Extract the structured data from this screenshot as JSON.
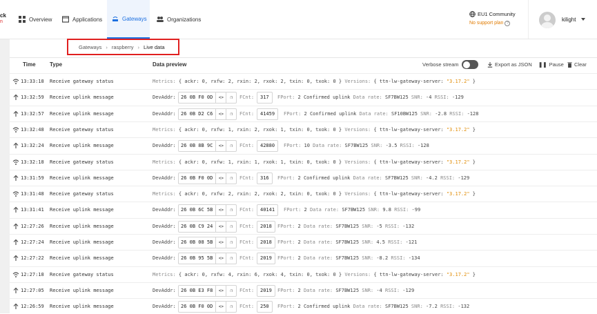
{
  "logo": {
    "line1": "ck",
    "line2": "n"
  },
  "nav": [
    {
      "label": "Overview",
      "icon": "overview-icon"
    },
    {
      "label": "Applications",
      "icon": "applications-icon"
    },
    {
      "label": "Gateways",
      "icon": "gateways-icon",
      "active": true
    },
    {
      "label": "Organizations",
      "icon": "organizations-icon"
    }
  ],
  "cluster": {
    "name": "EU1 Community",
    "plan": "No support plan"
  },
  "user": {
    "name": "kilight"
  },
  "breadcrumb": {
    "items": [
      "Gateways",
      "raspberry"
    ],
    "current": "Live data"
  },
  "table": {
    "headers": {
      "time": "Time",
      "type": "Type",
      "preview": "Data preview"
    },
    "tools": {
      "verbose": "Verbose stream",
      "export": "Export as JSON",
      "pause": "Pause",
      "clear": "Clear"
    }
  },
  "labels": {
    "metrics": "Metrics:",
    "versions": "Versions:",
    "devaddr": "DevAddr:",
    "fcnt": "FCnt:",
    "fport": "FPort:",
    "confirmed": "Confirmed uplink",
    "datarate": "Data rate:",
    "snr": "SNR:",
    "rssi": "RSSI:",
    "server": "ttn-lw-gateway-server:"
  },
  "rows": [
    {
      "kind": "status",
      "time": "13:33:18",
      "type": "Receive gateway status",
      "ackr": "0",
      "rxfw": "2",
      "rxin": "2",
      "rxok": "2",
      "txin": "0",
      "txok": "0",
      "version": "\"3.17.2\""
    },
    {
      "kind": "uplink",
      "time": "13:32:59",
      "type": "Receive uplink message",
      "devaddr": "26 0B F0 0D",
      "fcnt": "317",
      "fport": "2",
      "confirmed": true,
      "datarate": "SF7BW125",
      "snr": "-4",
      "rssi": "-129"
    },
    {
      "kind": "uplink",
      "time": "13:32:57",
      "type": "Receive uplink message",
      "devaddr": "26 0B D2 C6",
      "fcnt": "41459",
      "fport": "2",
      "confirmed": true,
      "datarate": "SF10BW125",
      "snr": "-2.8",
      "rssi": "-128"
    },
    {
      "kind": "status",
      "time": "13:32:48",
      "type": "Receive gateway status",
      "ackr": "0",
      "rxfw": "1",
      "rxin": "2",
      "rxok": "1",
      "txin": "0",
      "txok": "0",
      "version": "\"3.17.2\""
    },
    {
      "kind": "uplink",
      "time": "13:32:24",
      "type": "Receive uplink message",
      "devaddr": "26 0B 8B 9C",
      "fcnt": "42880",
      "fport": "10",
      "confirmed": false,
      "datarate": "SF7BW125",
      "snr": "-3.5",
      "rssi": "-128"
    },
    {
      "kind": "status",
      "time": "13:32:18",
      "type": "Receive gateway status",
      "ackr": "0",
      "rxfw": "1",
      "rxin": "1",
      "rxok": "1",
      "txin": "0",
      "txok": "0",
      "version": "\"3.17.2\""
    },
    {
      "kind": "uplink",
      "time": "13:31:59",
      "type": "Receive uplink message",
      "devaddr": "26 0B F0 0D",
      "fcnt": "316",
      "fport": "2",
      "confirmed": true,
      "datarate": "SF7BW125",
      "snr": "-4.2",
      "rssi": "-129"
    },
    {
      "kind": "status",
      "time": "13:31:48",
      "type": "Receive gateway status",
      "ackr": "0",
      "rxfw": "2",
      "rxin": "2",
      "rxok": "2",
      "txin": "0",
      "txok": "0",
      "version": "\"3.17.2\""
    },
    {
      "kind": "uplink",
      "time": "13:31:41",
      "type": "Receive uplink message",
      "devaddr": "26 0B 6C 5B",
      "fcnt": "40141",
      "fport": "2",
      "confirmed": false,
      "datarate": "SF7BW125",
      "snr": "9.8",
      "rssi": "-99"
    },
    {
      "kind": "uplink",
      "time": "12:27:26",
      "type": "Receive uplink message",
      "devaddr": "26 0B C9 24",
      "fcnt": "2018",
      "fport": "2",
      "confirmed": false,
      "datarate": "SF7BW125",
      "snr": "-5",
      "rssi": "-132"
    },
    {
      "kind": "uplink",
      "time": "12:27:24",
      "type": "Receive uplink message",
      "devaddr": "26 0B 08 5B",
      "fcnt": "2018",
      "fport": "2",
      "confirmed": false,
      "datarate": "SF7BW125",
      "snr": "4.5",
      "rssi": "-121"
    },
    {
      "kind": "uplink",
      "time": "12:27:22",
      "type": "Receive uplink message",
      "devaddr": "26 0B 95 5B",
      "fcnt": "2019",
      "fport": "2",
      "confirmed": false,
      "datarate": "SF7BW125",
      "snr": "-8.2",
      "rssi": "-134"
    },
    {
      "kind": "status",
      "time": "12:27:18",
      "type": "Receive gateway status",
      "ackr": "0",
      "rxfw": "4",
      "rxin": "6",
      "rxok": "4",
      "txin": "0",
      "txok": "0",
      "version": "\"3.17.2\""
    },
    {
      "kind": "uplink",
      "time": "12:27:05",
      "type": "Receive uplink message",
      "devaddr": "26 0B E3 F8",
      "fcnt": "2019",
      "fport": "2",
      "confirmed": false,
      "datarate": "SF7BW125",
      "snr": "-4",
      "rssi": "-129"
    },
    {
      "kind": "uplink",
      "time": "12:26:59",
      "type": "Receive uplink message",
      "devaddr": "26 0B F0 0D",
      "fcnt": "250",
      "fport": "2",
      "confirmed": true,
      "datarate": "SF7BW125",
      "snr": "-7.2",
      "rssi": "-132"
    }
  ],
  "colors": {
    "accent": "#1b6fe0",
    "highlight": "#e01f1f",
    "version": "#e08a00",
    "plan": "#e07b00"
  }
}
